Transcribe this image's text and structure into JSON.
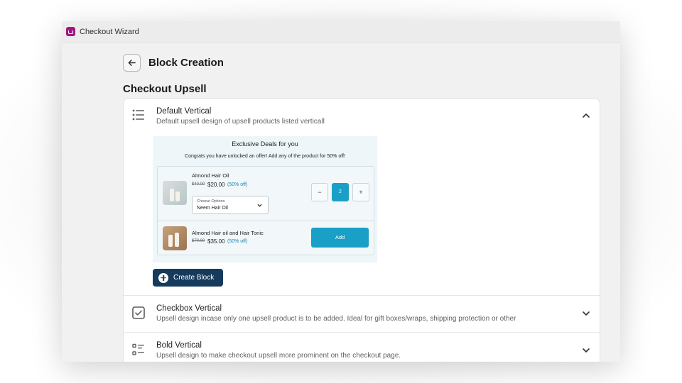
{
  "app": {
    "title": "Checkout Wizard"
  },
  "header": {
    "title": "Block Creation"
  },
  "section": {
    "title": "Checkout Upsell"
  },
  "accordion": [
    {
      "title": "Default Vertical",
      "description": "Default upsell design of upsell products listed verticall",
      "expanded": true,
      "icon": "list-icon"
    },
    {
      "title": "Checkbox Vertical",
      "description": "Upsell design incase only one upsell product is to be added. Ideal for gift boxes/wraps, shipping protection or other",
      "expanded": false,
      "icon": "checkbox-icon"
    },
    {
      "title": "Bold Vertical",
      "description": "Upsell design to make checkout upsell more prominent on the checkout page.",
      "expanded": false,
      "icon": "bold-list-icon"
    }
  ],
  "preview": {
    "title": "Exclusive Deals for you",
    "subtitle": "Congrats you have unlocked an offer! Add any of the product for 50% off!",
    "products": [
      {
        "name": "Almond Hair Oil",
        "old_price": "$40.00",
        "new_price": "$20.00",
        "discount": "(50% off)",
        "option_label": "Choose Options",
        "option_value": "Neem Hair Oil",
        "quantity": "2",
        "minus": "−",
        "plus": "+"
      },
      {
        "name": "Almond Hair oil and Hair Tonic",
        "old_price": "$70.00",
        "new_price": "$35.00",
        "discount": "(50% off)",
        "add_label": "Add"
      }
    ]
  },
  "create_button": {
    "label": "Create Block"
  },
  "colors": {
    "primary_button": "#163a5c",
    "accent": "#1a9fc7",
    "logo": "#a01a7d"
  }
}
